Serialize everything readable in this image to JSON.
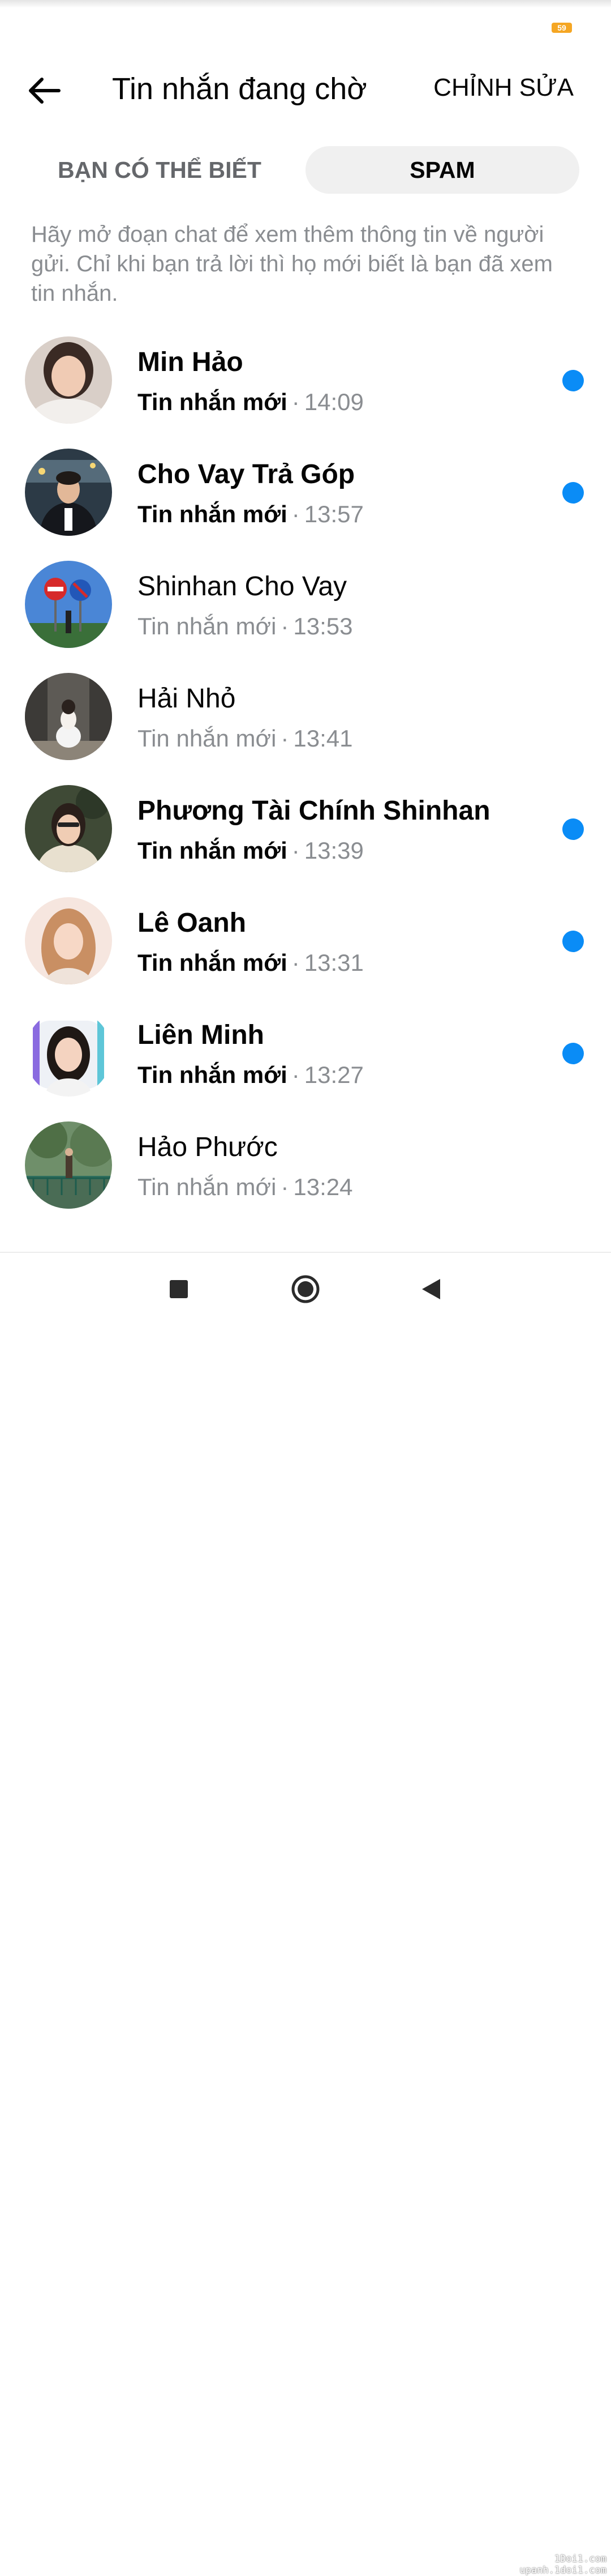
{
  "status_bar": {
    "battery": "59"
  },
  "header": {
    "title": "Tin nhắn đang chờ",
    "edit_label": "CHỈNH SỬA",
    "back_icon": "arrow-left-icon"
  },
  "tabs": [
    {
      "label": "BẠN CÓ THỂ BIẾT",
      "selected": false
    },
    {
      "label": "SPAM",
      "selected": true
    }
  ],
  "notice": "Hãy mở đoạn chat để xem thêm thông tin về người gửi. Chỉ khi bạn trả lời thì họ mới biết là bạn đã xem tin nhắn.",
  "conversations": [
    {
      "name": "Min Hảo",
      "message": "Tin nhắn mới",
      "time": "14:09",
      "unread": true
    },
    {
      "name": "Cho Vay Trả Góp",
      "message": "Tin nhắn mới",
      "time": "13:57",
      "unread": true
    },
    {
      "name": "Shinhan Cho Vay",
      "message": "Tin nhắn mới",
      "time": "13:53",
      "unread": false
    },
    {
      "name": "Hải Nhỏ",
      "message": "Tin nhắn mới",
      "time": "13:41",
      "unread": false
    },
    {
      "name": "Phương Tài Chính Shinhan",
      "message": "Tin nhắn mới",
      "time": "13:39",
      "unread": true
    },
    {
      "name": "Lê Oanh",
      "message": "Tin nhắn mới",
      "time": "13:31",
      "unread": true
    },
    {
      "name": "Liên Minh",
      "message": "Tin nhắn mới",
      "time": "13:27",
      "unread": true
    },
    {
      "name": "Hảo Phước",
      "message": "Tin nhắn mới",
      "time": "13:24",
      "unread": false
    }
  ],
  "separator": "·",
  "colors": {
    "accent": "#0a8cf6",
    "secondary_text": "#8a8d91",
    "selected_tab_bg": "#f0f0f0"
  },
  "nav_bar": {
    "icons": [
      "square-recents-icon",
      "circle-home-icon",
      "triangle-back-icon"
    ]
  },
  "watermark": {
    "line1": "1Doi1.com",
    "line2": "upanh.1doi1.com"
  }
}
